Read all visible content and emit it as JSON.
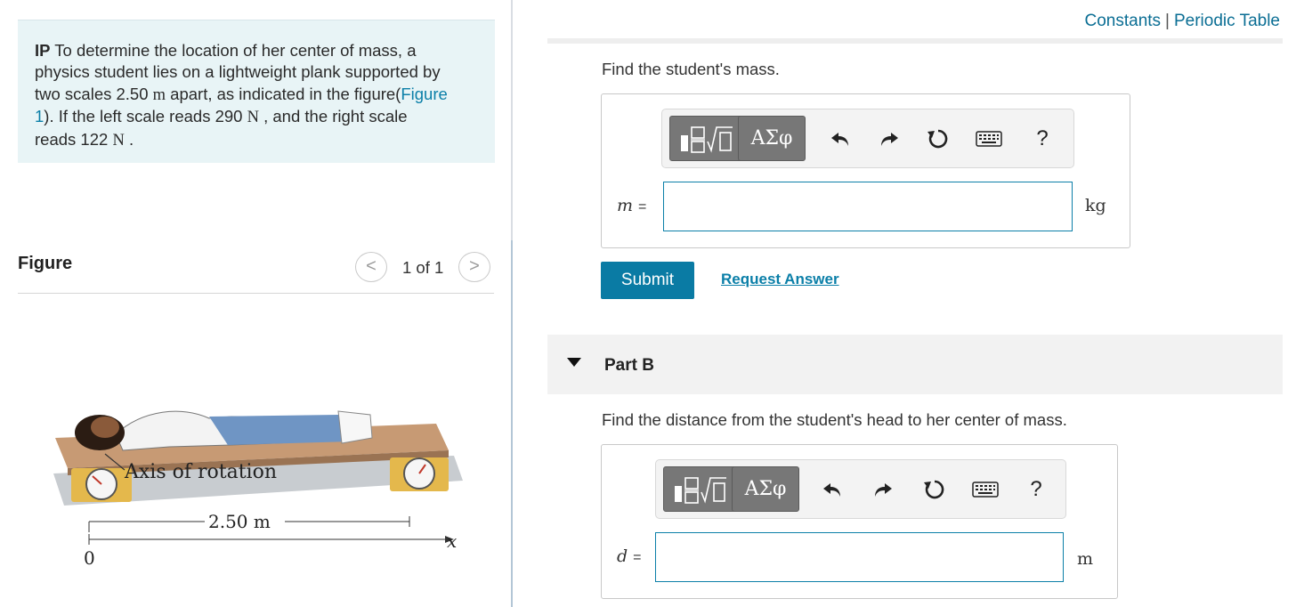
{
  "problem": {
    "prefix": "IP",
    "line1": " To determine the location of her center of mass, a",
    "line2": "physics student lies on a lightweight plank supported by",
    "line3a": "two scales 2.50 ",
    "line3b": "m",
    "line3c": " apart, as indicated in the figure(",
    "figure_link": "Figure",
    "line4a": "1",
    "line4b": "). If the left scale reads 290 ",
    "line4c": "N",
    "line4d": " , and the right scale",
    "line5a": "reads 122 ",
    "line5b": "N",
    "line5c": " ."
  },
  "figure": {
    "title": "Figure",
    "pager_text": "1 of 1",
    "prev_symbol": "<",
    "next_symbol": ">",
    "axis_label": "Axis of rotation",
    "distance_label": "2.50 m",
    "origin_label": "0",
    "x_label": "x"
  },
  "header": {
    "constants": "Constants",
    "separator": "|",
    "periodic_table": "Periodic Table"
  },
  "part_a": {
    "prompt": "Find the student's mass.",
    "variable": "m",
    "equals": "=",
    "input_value": "",
    "unit": "kg",
    "symbols_label": "ΑΣφ",
    "help": "?",
    "submit": "Submit",
    "request": "Request Answer"
  },
  "part_b": {
    "title": "Part B",
    "prompt": "Find the distance from the student's head to her center of mass.",
    "variable": "d",
    "equals": "=",
    "input_value": "",
    "unit": "m",
    "symbols_label": "ΑΣφ",
    "help": "?"
  },
  "colors": {
    "accent": "#0a7ba4",
    "problem_bg": "#e8f4f6",
    "toolbar_button": "#777777"
  }
}
